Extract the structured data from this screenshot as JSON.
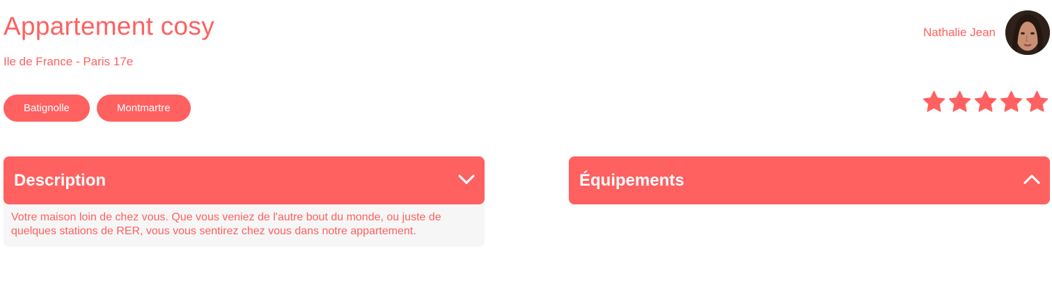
{
  "listing": {
    "title": "Appartement cosy",
    "location": "Ile de France - Paris 17e",
    "tags": [
      "Batignolle",
      "Montmartre"
    ]
  },
  "host": {
    "name": "Nathalie Jean",
    "avatar_icon": "host-avatar"
  },
  "rating": {
    "value": 5,
    "max": 5,
    "color": "#ff6060"
  },
  "collapses": {
    "description": {
      "title": "Description",
      "expanded": true,
      "chevron_icon": "chevron-down-icon",
      "text": "Votre maison loin de chez vous. Que vous veniez de l'autre bout du monde, ou juste de quelques stations de RER, vous vous sentirez chez vous dans notre appartement."
    },
    "equipements": {
      "title": "Équipements",
      "expanded": false,
      "chevron_icon": "chevron-up-icon"
    }
  },
  "colors": {
    "accent": "#ff6060",
    "panel_bg": "#f6f6f6"
  }
}
